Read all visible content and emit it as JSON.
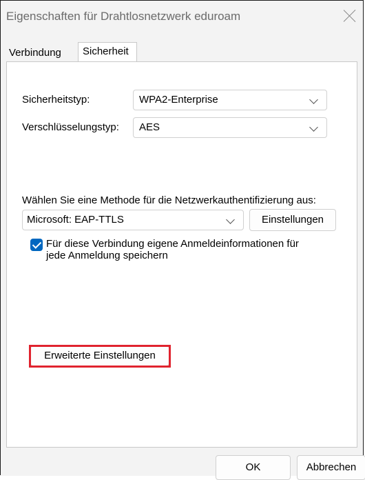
{
  "window": {
    "title": "Eigenschaften für Drahtlosnetzwerk eduroam",
    "close_icon": "close-icon"
  },
  "tabs": [
    {
      "label": "Verbindung",
      "selected": false
    },
    {
      "label": "Sicherheit",
      "selected": true
    }
  ],
  "security": {
    "security_type_label": "Sicherheitstyp:",
    "security_type_value": "WPA2-Enterprise",
    "encryption_type_label": "Verschlüsselungstyp:",
    "encryption_type_value": "AES",
    "auth_method_prompt": "Wählen Sie eine Methode für die Netzwerkauthentifizierung aus:",
    "auth_method_value": "Microsoft: EAP-TTLS",
    "settings_button": "Einstellungen",
    "remember_credentials_line1": "Für diese Verbindung eigene Anmeldeinformationen für",
    "remember_credentials_line2": "jede Anmeldung speichern",
    "remember_credentials_checked": true,
    "advanced_settings_button": "Erweiterte Einstellungen",
    "highlight_color": "#e0232e",
    "checkbox_color": "#0067c0"
  },
  "footer": {
    "ok_button": "OK",
    "cancel_button": "Abbrechen"
  }
}
